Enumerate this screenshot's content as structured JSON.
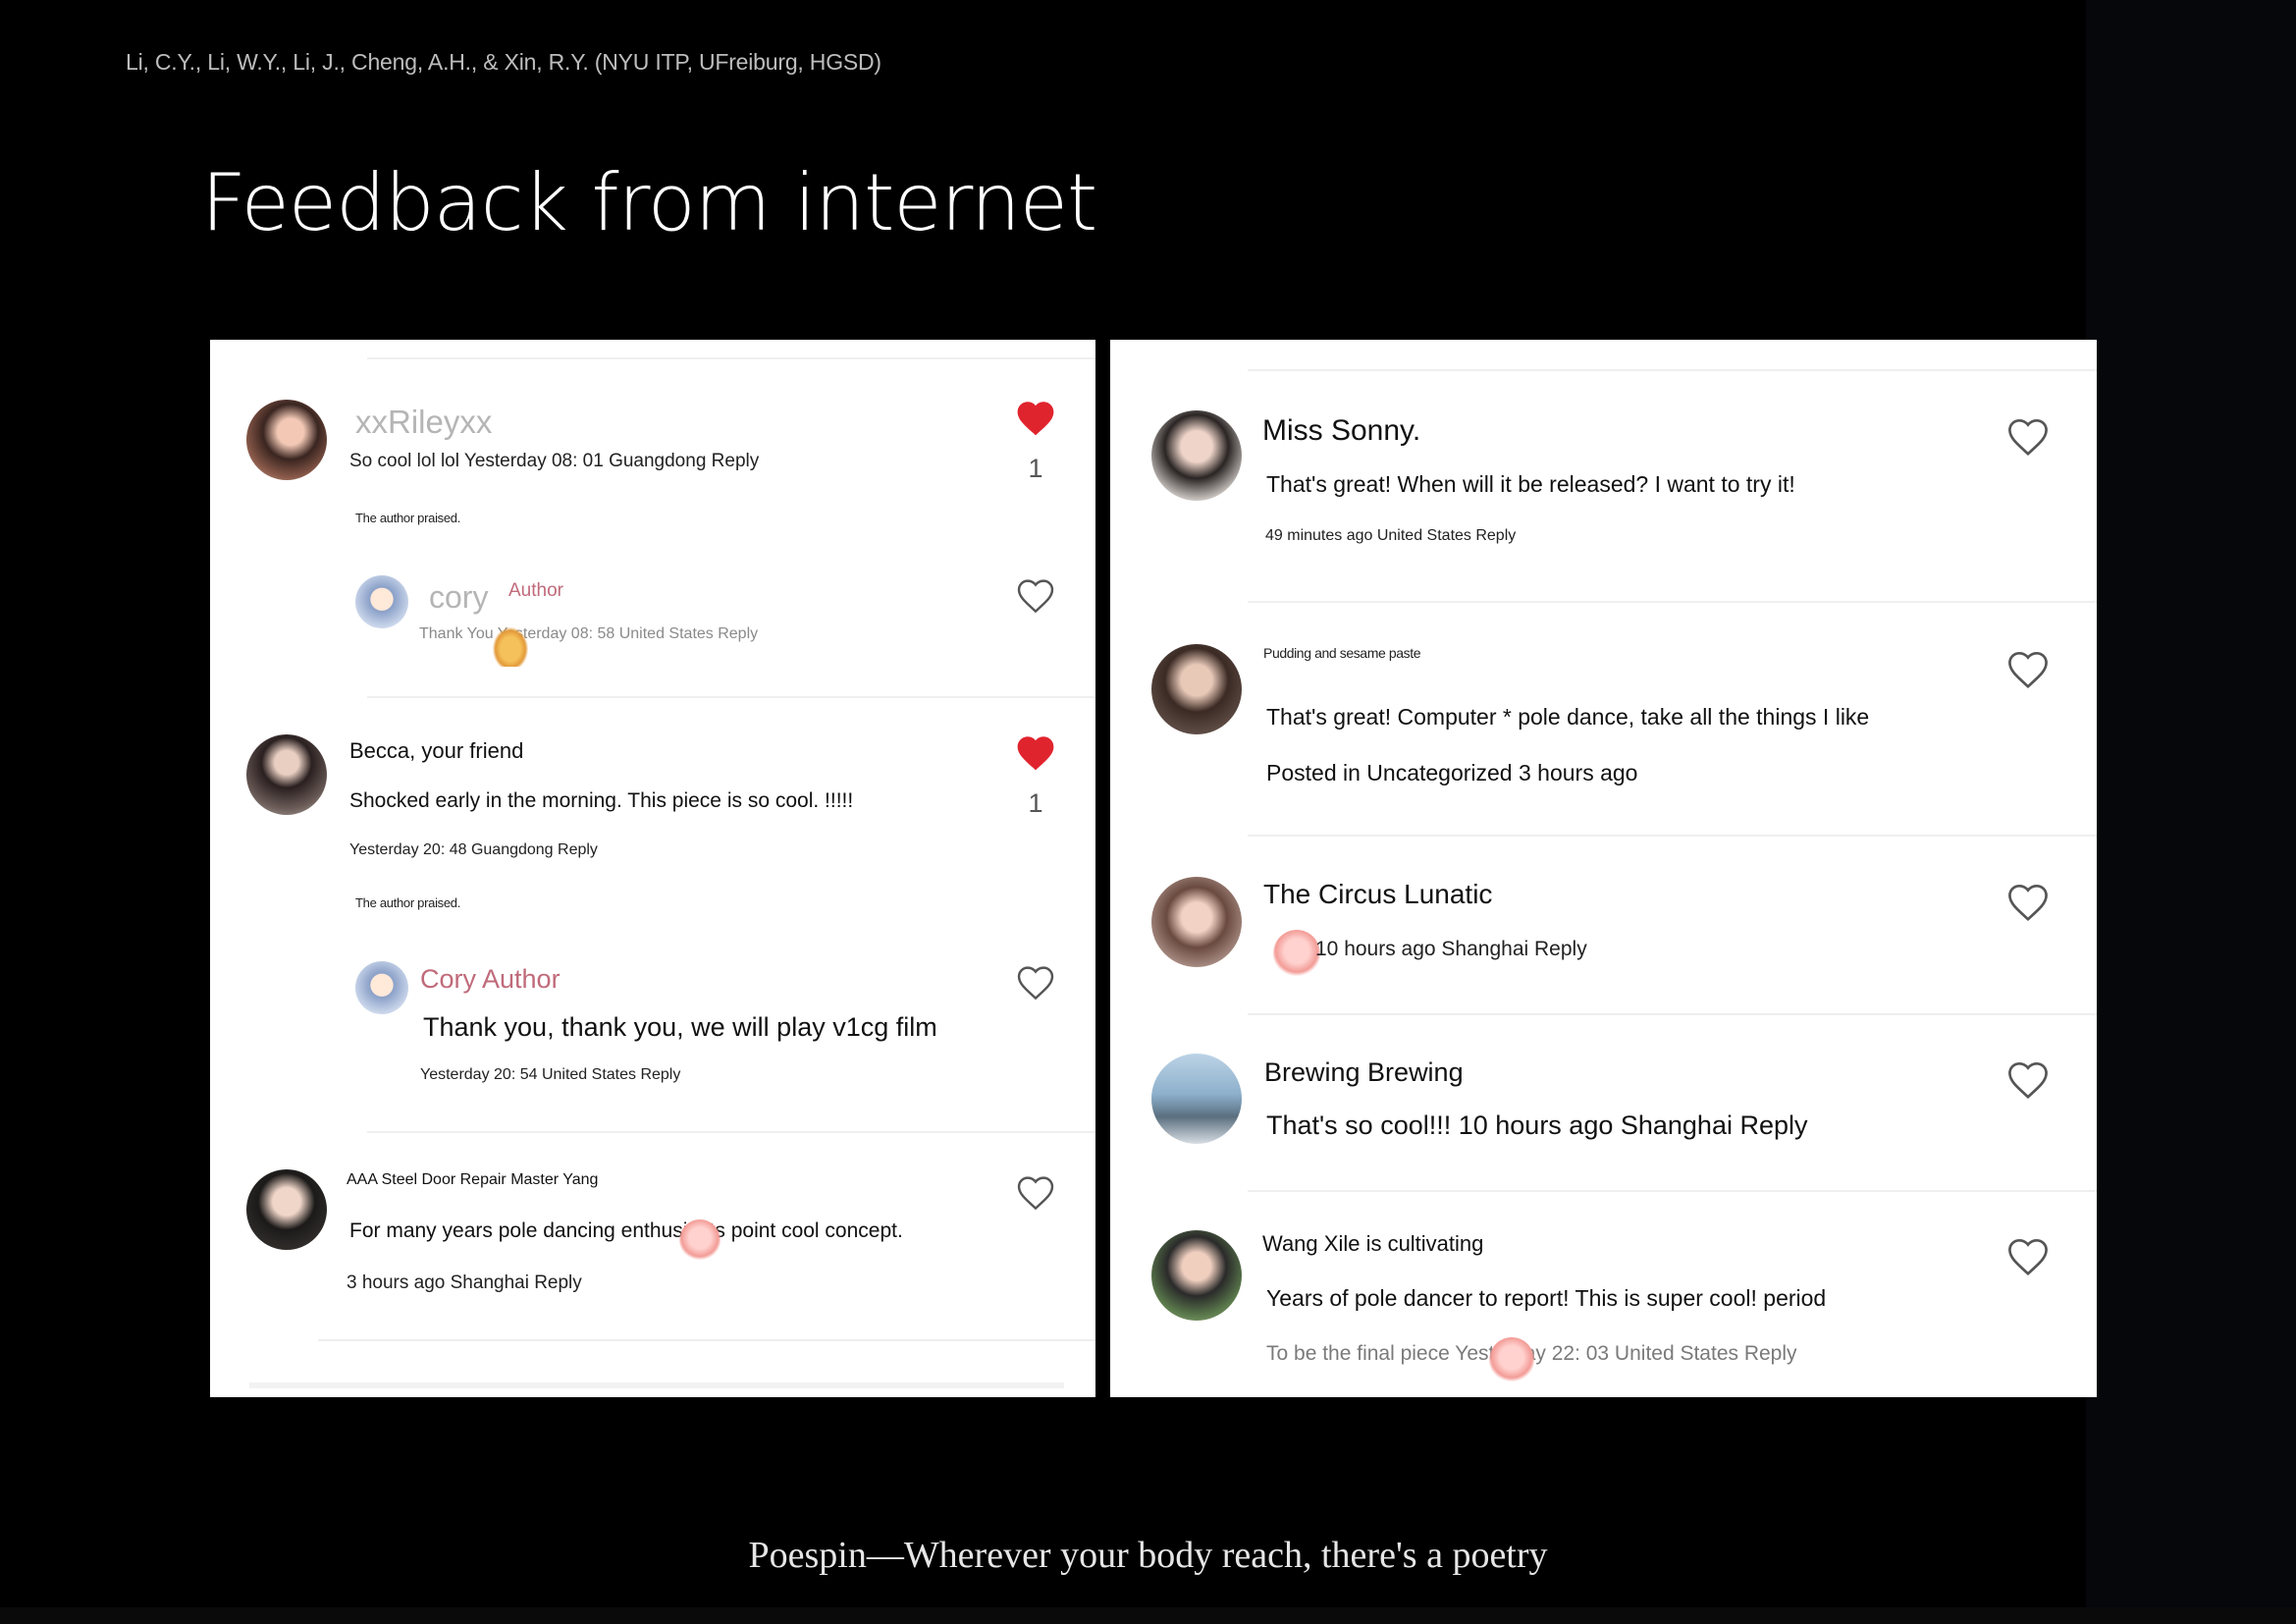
{
  "slide": {
    "credit": "Li, C.Y., Li, W.Y., Li, J., Cheng, A.H., & Xin, R.Y. (NYU ITP, UFreiburg, HGSD)",
    "title": "Feedback from internet",
    "tagline": "Poespin—Wherever your body reach, there's a poetry"
  },
  "left_panel": {
    "comments": [
      {
        "username": "xxRileyxx",
        "text": "So cool lol lol Yesterday 08: 01 Guangdong Reply",
        "note": "The author praised.",
        "likes": "1",
        "liked": true,
        "reply": {
          "username": "cory",
          "badge": "Author",
          "text": "Thank You Yesterday 08: 58 United States Reply"
        }
      },
      {
        "username": "Becca, your friend",
        "text": "Shocked early in the morning. This piece is so cool. !!!!!",
        "meta": "Yesterday 20: 48 Guangdong Reply",
        "note": "The author praised.",
        "likes": "1",
        "liked": true,
        "reply": {
          "username": "Cory Author",
          "text": "Thank you, thank you, we will play v1cg film",
          "meta": "Yesterday 20: 54 United States Reply"
        }
      },
      {
        "username": "AAA Steel Door Repair Master Yang",
        "text": "For many years pole dancing enthusiasts point cool concept.",
        "meta": "3 hours ago Shanghai Reply",
        "liked": false
      }
    ]
  },
  "right_panel": {
    "comments": [
      {
        "username": "Miss Sonny.",
        "text": "That's great! When will it be released? I want to try it!",
        "meta": "49 minutes ago United States Reply"
      },
      {
        "username": "Pudding and sesame paste",
        "text": "That's great! Computer * pole dance, take all the things I like",
        "meta": "Posted in Uncategorized 3 hours ago"
      },
      {
        "username": "The Circus Lunatic",
        "meta": "10 hours ago Shanghai Reply"
      },
      {
        "username": "Brewing Brewing",
        "text": "That's so cool!!! 10 hours ago Shanghai Reply"
      },
      {
        "username": "Wang Xile is cultivating",
        "text": "Years of pole dancer to report! This is super cool! period",
        "meta": "To be the final piece Yesterday 22: 03 United States Reply"
      }
    ]
  },
  "colors": {
    "background": "#000000",
    "panel": "#ffffff",
    "like_red": "#e0242e",
    "author_pink": "#c06a7a"
  },
  "icons": {
    "like_filled": "heart-filled-icon",
    "like_empty": "heart-outline-icon",
    "emoji": "emoji-sticker-icon"
  }
}
